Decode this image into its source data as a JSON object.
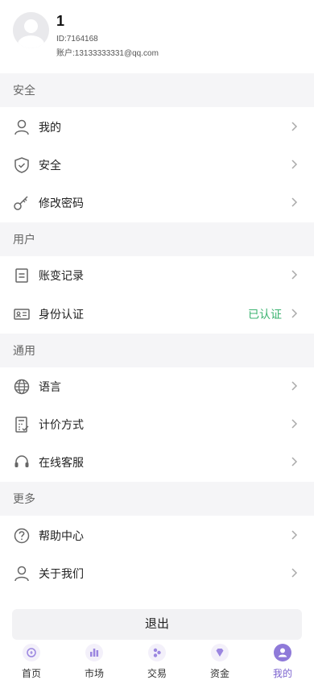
{
  "profile": {
    "name": "1",
    "id": "ID:7164168",
    "account": "账户:13133333331@qq.com"
  },
  "sections": {
    "security": "安全",
    "user": "用户",
    "general": "通用",
    "more": "更多"
  },
  "rows": {
    "mine": "我的",
    "security": "安全",
    "change_password": "修改密码",
    "account_changes": "账变记录",
    "identity": "身份认证",
    "identity_status": "已认证",
    "language": "语言",
    "pricing": "计价方式",
    "support": "在线客服",
    "help": "帮助中心",
    "about": "关于我们"
  },
  "logout": "退出",
  "tabbar": {
    "home": "首页",
    "market": "市场",
    "trade": "交易",
    "funds": "资金",
    "mine": "我的"
  },
  "colors": {
    "accent": "#7b62cf",
    "verified": "#3cb371",
    "section_bg": "#f5f5f7"
  }
}
